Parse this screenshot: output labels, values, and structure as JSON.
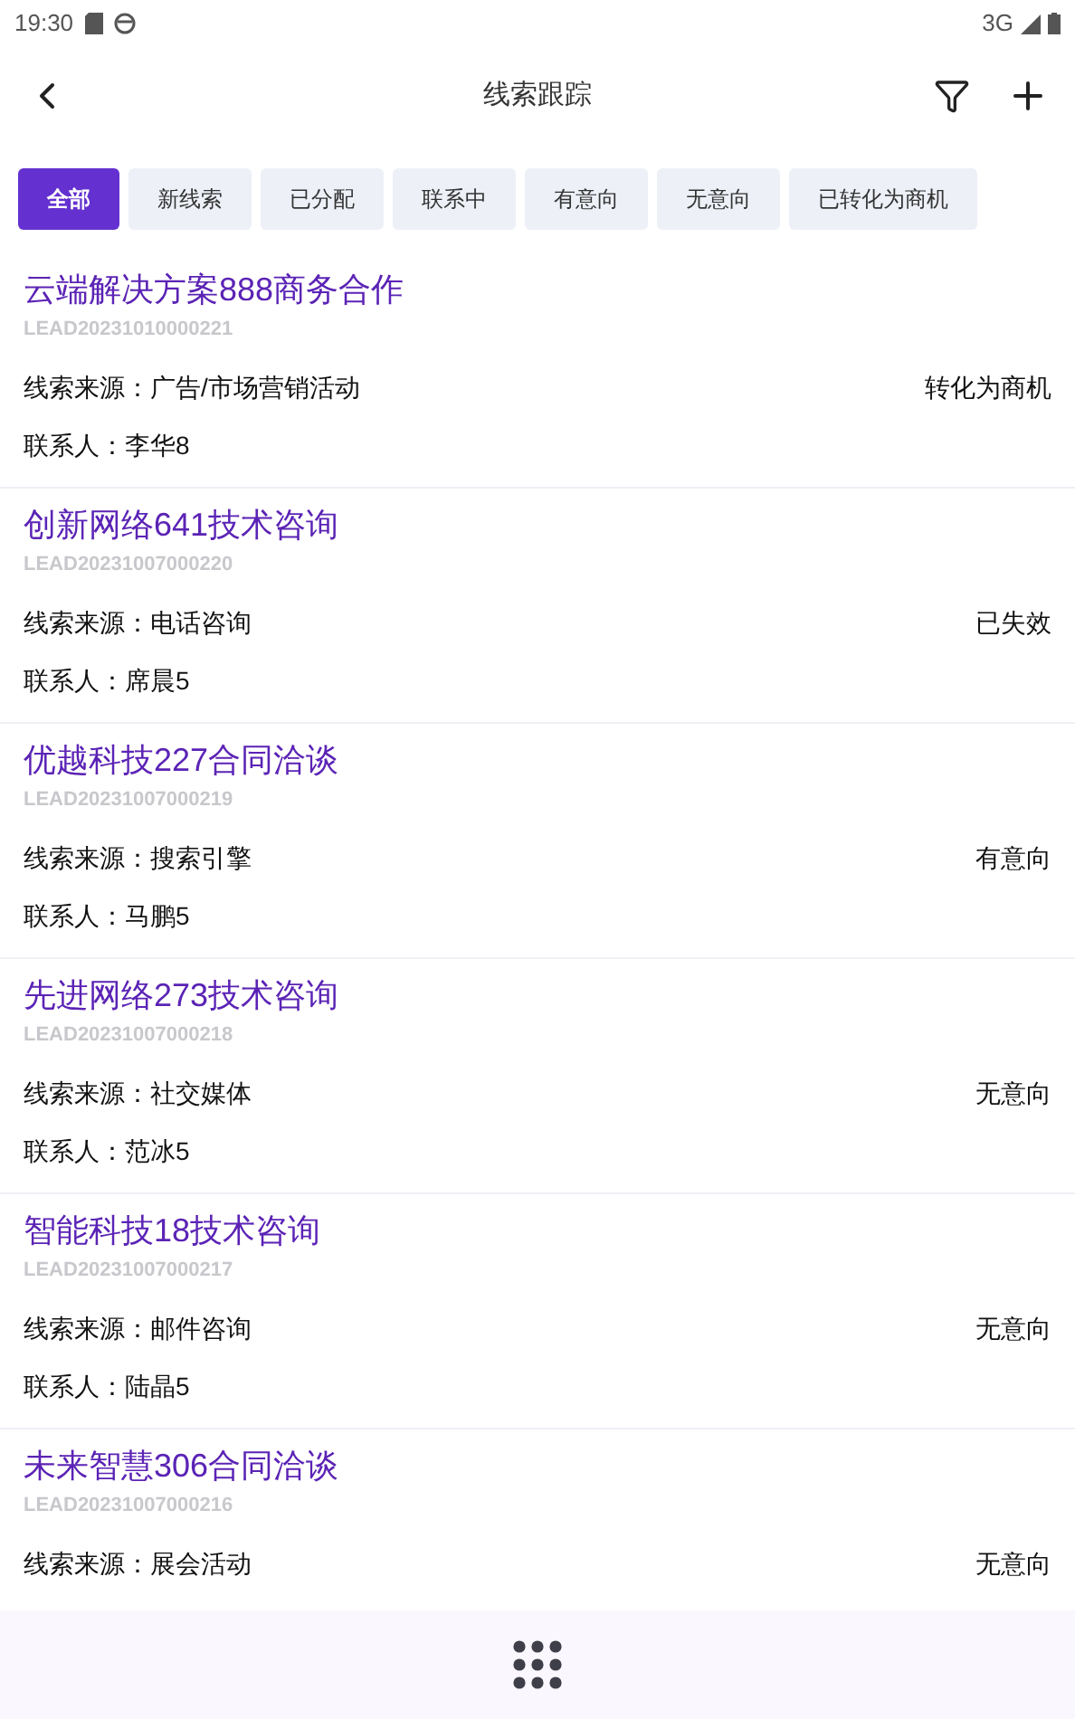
{
  "status_bar": {
    "time": "19:30",
    "network": "3G"
  },
  "header": {
    "title": "线索跟踪"
  },
  "tabs": [
    {
      "label": "全部",
      "selected": true
    },
    {
      "label": "新线索",
      "selected": false
    },
    {
      "label": "已分配",
      "selected": false
    },
    {
      "label": "联系中",
      "selected": false
    },
    {
      "label": "有意向",
      "selected": false
    },
    {
      "label": "无意向",
      "selected": false
    },
    {
      "label": "已转化为商机",
      "selected": false
    }
  ],
  "leads": [
    {
      "title": "云端解决方案888商务合作",
      "code": "LEAD20231010000221",
      "source": "线索来源：广告/市场营销活动",
      "status": "转化为商机",
      "contact": "联系人：李华8"
    },
    {
      "title": "创新网络641技术咨询",
      "code": "LEAD20231007000220",
      "source": "线索来源：电话咨询",
      "status": "已失效",
      "contact": "联系人：席晨5"
    },
    {
      "title": "优越科技227合同洽谈",
      "code": "LEAD20231007000219",
      "source": "线索来源：搜索引擎",
      "status": "有意向",
      "contact": "联系人：马鹏5"
    },
    {
      "title": "先进网络273技术咨询",
      "code": "LEAD20231007000218",
      "source": "线索来源：社交媒体",
      "status": "无意向",
      "contact": "联系人：范冰5"
    },
    {
      "title": "智能科技18技术咨询",
      "code": "LEAD20231007000217",
      "source": "线索来源：邮件咨询",
      "status": "无意向",
      "contact": "联系人：陆晶5"
    },
    {
      "title": "未来智慧306合同洽谈",
      "code": "LEAD20231007000216",
      "source": "线索来源：展会活动",
      "status": "无意向"
    }
  ]
}
